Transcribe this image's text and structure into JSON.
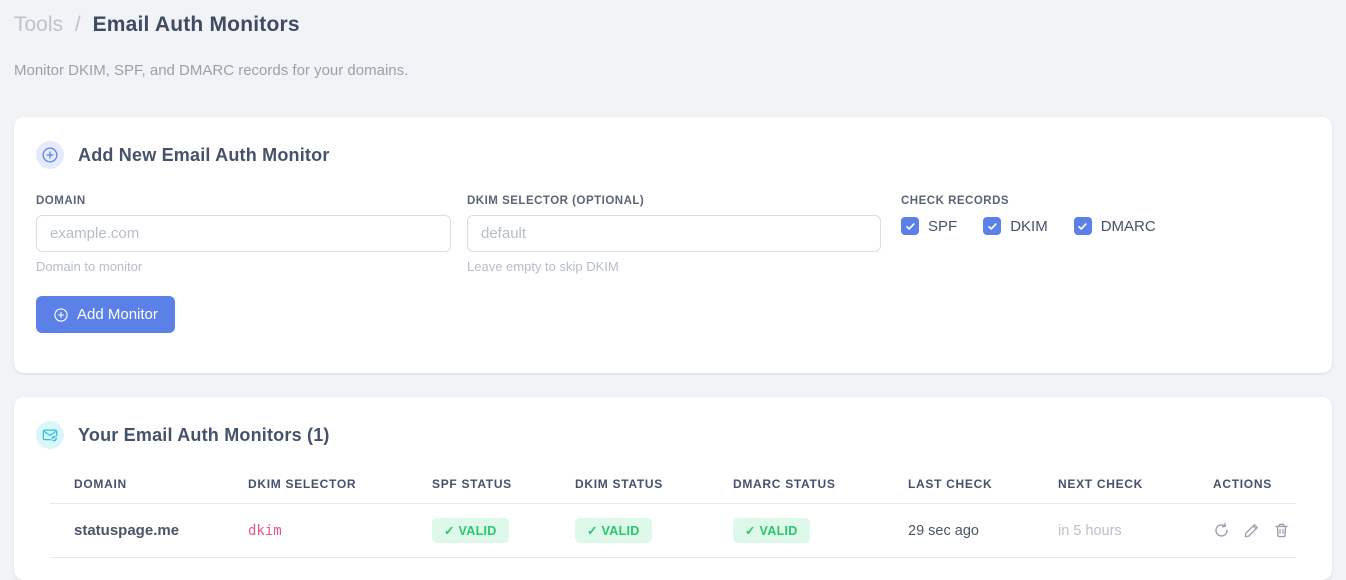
{
  "breadcrumb": {
    "parent": "Tools",
    "separator": "/",
    "current": "Email Auth Monitors"
  },
  "subtitle": "Monitor DKIM, SPF, and DMARC records for your domains.",
  "add_card": {
    "icon": "plus-circle-icon",
    "title": "Add New Email Auth Monitor",
    "fields": {
      "domain": {
        "label": "DOMAIN",
        "value": "",
        "placeholder": "example.com",
        "helper": "Domain to monitor"
      },
      "dkim_selector": {
        "label": "DKIM SELECTOR (OPTIONAL)",
        "value": "",
        "placeholder": "default",
        "helper": "Leave empty to skip DKIM"
      }
    },
    "check_records": {
      "label": "CHECK RECORDS",
      "options": [
        {
          "label": "SPF",
          "checked": true
        },
        {
          "label": "DKIM",
          "checked": true
        },
        {
          "label": "DMARC",
          "checked": true
        }
      ]
    },
    "submit_label": "Add Monitor"
  },
  "monitors_card": {
    "icon": "envelope-check-icon",
    "title": "Your Email Auth Monitors (1)",
    "table": {
      "columns": [
        "DOMAIN",
        "DKIM SELECTOR",
        "SPF STATUS",
        "DKIM STATUS",
        "DMARC STATUS",
        "LAST CHECK",
        "NEXT CHECK",
        "ACTIONS"
      ],
      "rows": [
        {
          "domain": "statuspage.me",
          "dkim_selector": "dkim",
          "spf_status": "✓ VALID",
          "dkim_status": "✓ VALID",
          "dmarc_status": "✓ VALID",
          "last_check": "29 sec ago",
          "next_check": "in 5 hours",
          "action_icons": [
            "refresh-icon",
            "edit-pencil-icon",
            "trash-icon"
          ]
        }
      ]
    }
  },
  "colors": {
    "accent_blue": "#5b80e8",
    "icon_cyan": "#2bc4dd",
    "badge_green_text": "#29c76f",
    "badge_green_bg": "#def8ea",
    "selector_pink": "#ee5586",
    "page_bg": "#f2f3f6"
  }
}
